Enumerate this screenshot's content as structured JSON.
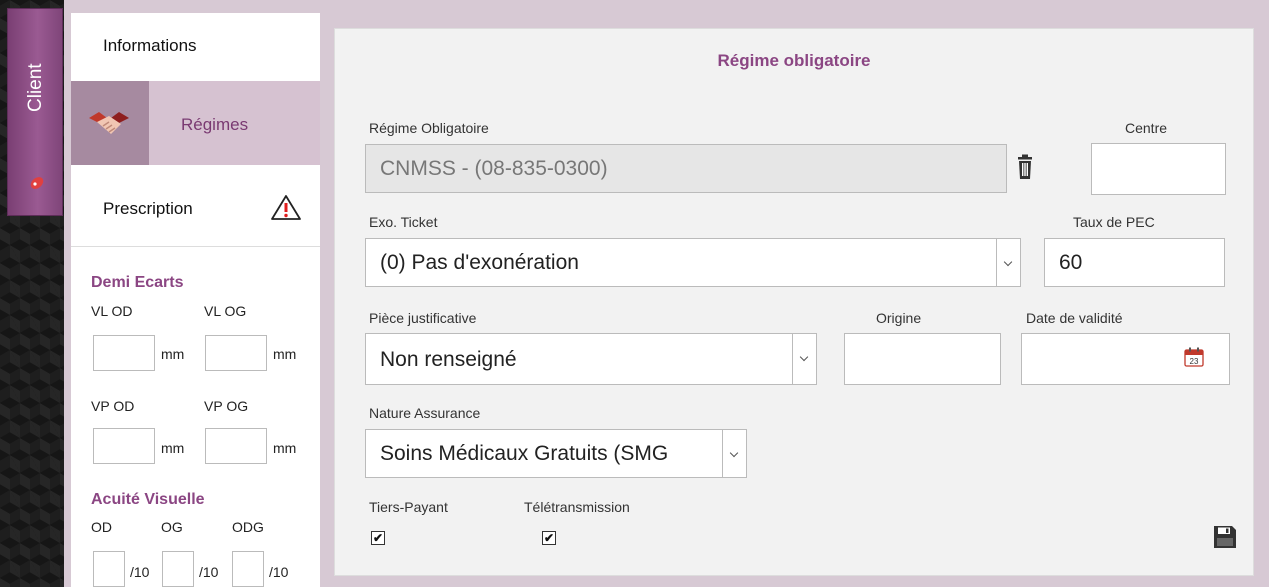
{
  "client_tab": {
    "label": "Client"
  },
  "sidebar": {
    "tabs": [
      {
        "label": "Informations"
      },
      {
        "label": "Régimes"
      },
      {
        "label": "Prescription"
      }
    ],
    "demi_ecarts": {
      "title": "Demi Ecarts",
      "vl_od": "VL OD",
      "vl_og": "VL OG",
      "vp_od": "VP OD",
      "vp_og": "VP OG",
      "unit": "mm"
    },
    "acuite": {
      "title": "Acuité Visuelle",
      "od": "OD",
      "og": "OG",
      "odg": "ODG",
      "unit": "/10"
    }
  },
  "panel": {
    "title": "Régime obligatoire",
    "regime_obligatoire": {
      "label": "Régime Obligatoire",
      "value": "CNMSS - (08-835-0300)"
    },
    "centre": {
      "label": "Centre",
      "value": ""
    },
    "exo_ticket": {
      "label": "Exo. Ticket",
      "value": "(0) Pas d'exonération"
    },
    "taux_pec": {
      "label": "Taux de PEC",
      "value": "60"
    },
    "piece_justificative": {
      "label": "Pièce justificative",
      "value": "Non renseigné"
    },
    "origine": {
      "label": "Origine",
      "value": ""
    },
    "date_validite": {
      "label": "Date de validité",
      "value": ""
    },
    "nature_assurance": {
      "label": "Nature Assurance",
      "value": "Soins Médicaux Gratuits (SMG"
    },
    "tiers_payant": {
      "label": "Tiers-Payant",
      "checked": true
    },
    "teletransmission": {
      "label": "Télétransmission",
      "checked": true
    },
    "calendar_day": "23"
  },
  "colors": {
    "accent": "#8b4683",
    "background": "#d7c9d4"
  }
}
